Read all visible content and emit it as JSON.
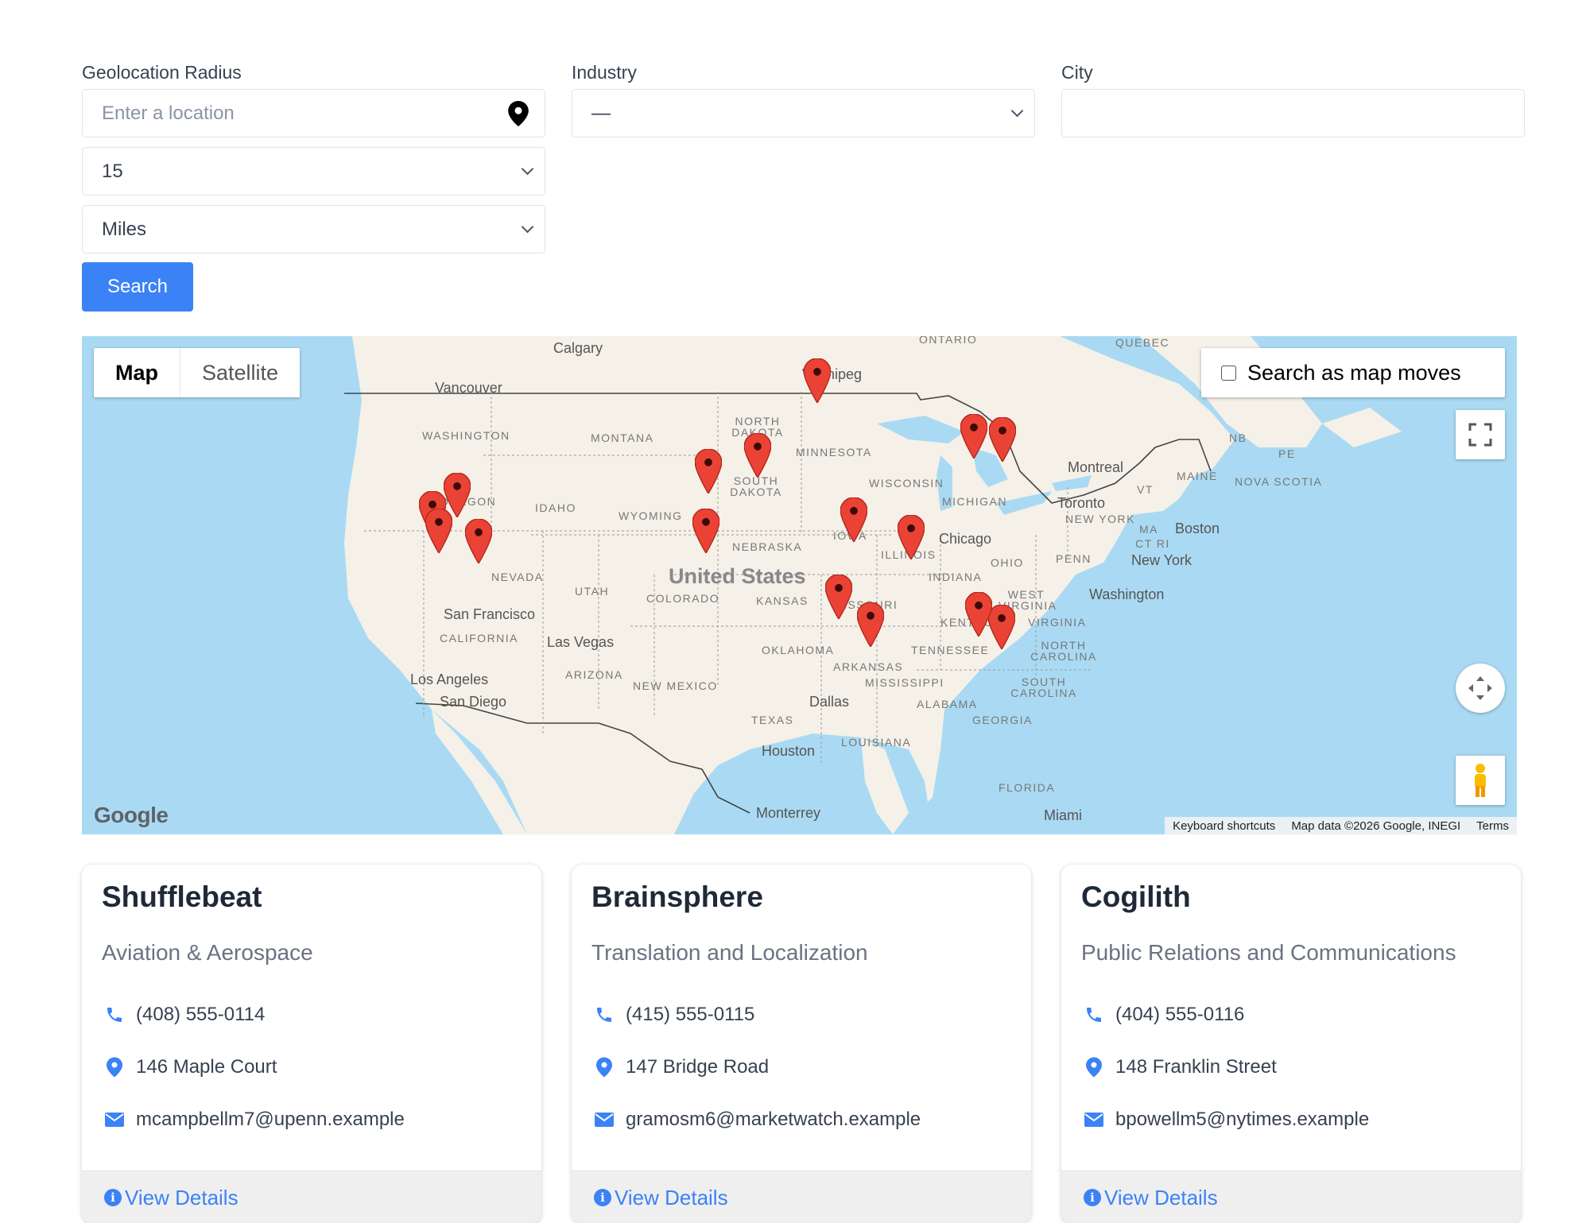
{
  "filters": {
    "geolocation_label": "Geolocation Radius",
    "location_placeholder": "Enter a location",
    "radius_value": "15",
    "units_value": "Miles",
    "search_label": "Search",
    "industry_label": "Industry",
    "industry_value": "—",
    "city_label": "City",
    "city_value": ""
  },
  "map": {
    "tab_map": "Map",
    "tab_satellite": "Satellite",
    "search_as_moves": "Search as map moves",
    "google_logo": "Google",
    "keyboard_shortcuts": "Keyboard shortcuts",
    "map_data": "Map data ©2026 Google, INEGI",
    "terms": "Terms",
    "country": "United States",
    "cities": [
      "Calgary",
      "Winnipeg",
      "Vancouver",
      "Montreal",
      "Toronto",
      "Boston",
      "New York",
      "Washington",
      "Chicago",
      "San Francisco",
      "Las Vegas",
      "Los Angeles",
      "San Diego",
      "Dallas",
      "Houston",
      "Monterrey",
      "Miami"
    ],
    "regions": [
      "ONTARIO",
      "QUEBEC",
      "WASHINGTON",
      "MONTANA",
      "NORTH DAKOTA",
      "MINNESOTA",
      "NB",
      "PE",
      "MAINE",
      "NOVA SCOTIA",
      "OREGON",
      "IDAHO",
      "WYOMING",
      "SOUTH DAKOTA",
      "WISCONSIN",
      "MICHIGAN",
      "VT",
      "NEW YORK",
      "MA",
      "CT RI",
      "NEBRASKA",
      "IOWA",
      "ILLINOIS",
      "OHIO",
      "PENN",
      "NEVADA",
      "UTAH",
      "COLORADO",
      "KANSAS",
      "MISSOURI",
      "INDIANA",
      "WEST VIRGINIA",
      "VIRGINIA",
      "CALIFORNIA",
      "KENTUCKY",
      "OKLAHOMA",
      "TENNESSEE",
      "NORTH CAROLINA",
      "ARIZONA",
      "NEW MEXICO",
      "ARKANSAS",
      "MISSISSIPPI",
      "SOUTH CAROLINA",
      "ALABAMA",
      "TEXAS",
      "LOUISIANA",
      "GEORGIA",
      "FLORIDA"
    ],
    "marker_color": "#ea4335"
  },
  "cards": [
    {
      "name": "Shufflebeat",
      "industry": "Aviation & Aerospace",
      "phone": "(408) 555-0114",
      "address": "146 Maple Court",
      "email": "mcampbellm7@upenn.example",
      "details": "View Details"
    },
    {
      "name": "Brainsphere",
      "industry": "Translation and Localization",
      "phone": "(415) 555-0115",
      "address": "147 Bridge Road",
      "email": "gramosm6@marketwatch.example",
      "details": "View Details"
    },
    {
      "name": "Cogilith",
      "industry": "Public Relations and Communications",
      "phone": "(404) 555-0116",
      "address": "148 Franklin Street",
      "email": "bpowellm5@nytimes.example",
      "details": "View Details"
    }
  ],
  "colors": {
    "accent": "#3b82f6",
    "water": "#aadaf3",
    "land": "#f5f1e8"
  }
}
